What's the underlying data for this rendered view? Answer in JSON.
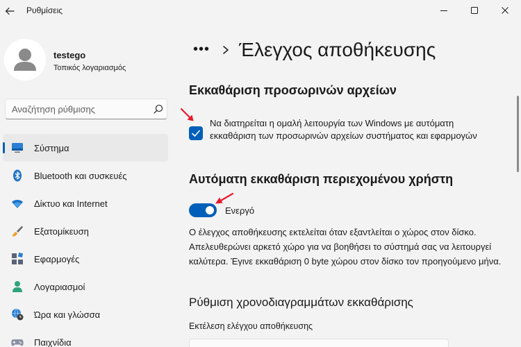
{
  "window": {
    "title": "Ρυθμίσεις"
  },
  "user": {
    "name": "testego",
    "account_type": "Τοπικός λογαριασμός"
  },
  "search": {
    "placeholder": "Αναζήτηση ρύθμισης"
  },
  "sidebar": {
    "items": [
      {
        "label": "Σύστημα",
        "icon": "system-icon",
        "active": true
      },
      {
        "label": "Bluetooth και συσκευές",
        "icon": "bluetooth-icon",
        "active": false
      },
      {
        "label": "Δίκτυο και Internet",
        "icon": "wifi-icon",
        "active": false
      },
      {
        "label": "Εξατομίκευση",
        "icon": "brush-icon",
        "active": false
      },
      {
        "label": "Εφαρμογές",
        "icon": "apps-icon",
        "active": false
      },
      {
        "label": "Λογαριασμοί",
        "icon": "account-icon",
        "active": false
      },
      {
        "label": "Ώρα και γλώσσα",
        "icon": "globe-clock-icon",
        "active": false
      },
      {
        "label": "Παιχνίδια",
        "icon": "gamepad-icon",
        "active": false
      }
    ]
  },
  "breadcrumb": {
    "more": "•••",
    "current": "Έλεγχος αποθήκευσης"
  },
  "cleanup_temp": {
    "title": "Εκκαθάριση προσωρινών αρχείων",
    "checkbox_label": "Να διατηρείται η ομαλή λειτουργία των Windows με αυτόματη εκκαθάριση των προσωρινών αρχείων συστήματος και εφαρμογών",
    "checked": true
  },
  "auto_cleanup": {
    "title": "Αυτόματη εκκαθάριση περιεχομένου χρήστη",
    "toggle_label": "Ενεργό",
    "toggle_on": true,
    "description": "Ο έλεγχος αποθήκευσης εκτελείται όταν εξαντλείται ο χώρος στον δίσκο. Απελευθερώνει αρκετό χώρο για να βοηθήσει το σύστημά σας να λειτουργεί καλύτερα. Έγινε εκκαθάριση 0 byte χώρου στον δίσκο τον προηγούμενο μήνα."
  },
  "schedule": {
    "title": "Ρύθμιση χρονοδιαγραμμάτων εκκαθάρισης",
    "run_label": "Εκτέλεση ελέγχου αποθήκευσης"
  },
  "colors": {
    "accent": "#005fb8",
    "annotation_arrow": "#e8192c",
    "background": "#f3f3f3"
  }
}
